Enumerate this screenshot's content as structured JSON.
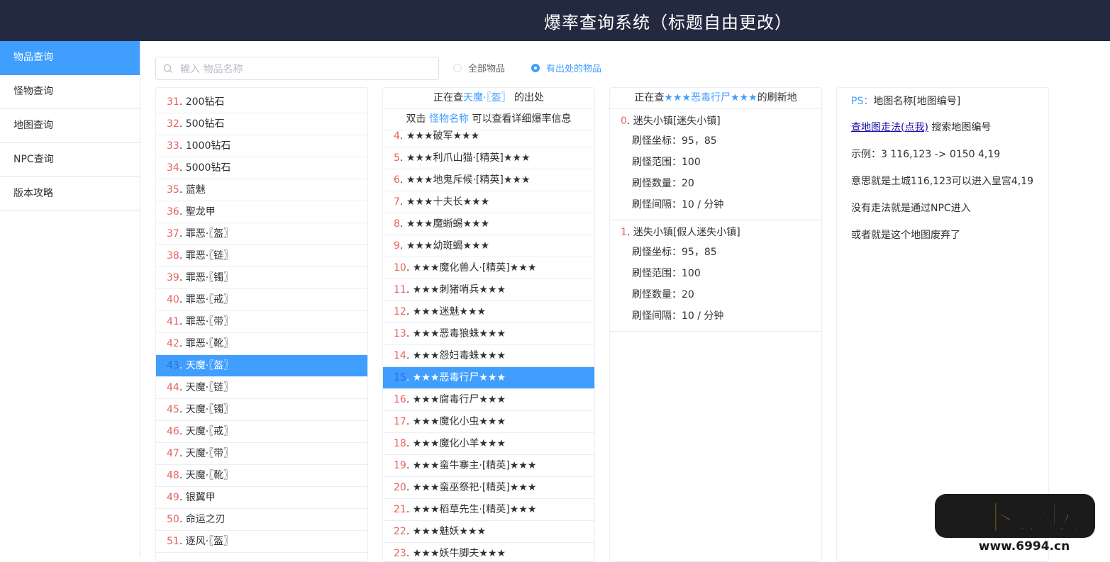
{
  "header": {
    "title": "爆率查询系统（标题自由更改）"
  },
  "sidebar": {
    "items": [
      {
        "label": "物品查询"
      },
      {
        "label": "怪物查询"
      },
      {
        "label": "地图查询"
      },
      {
        "label": "NPC查询"
      },
      {
        "label": "版本攻略"
      }
    ]
  },
  "search": {
    "placeholder": "输入 物品名称",
    "value": "",
    "icon": "search-icon"
  },
  "filters": {
    "all_label": "全部物品",
    "with_source_label": "有出处的物品",
    "selected": "有出处的物品"
  },
  "items_list": {
    "selected_num": "43",
    "rows": [
      {
        "num": "31",
        "name": "200钻石"
      },
      {
        "num": "32",
        "name": "500钻石"
      },
      {
        "num": "33",
        "name": "1000钻石"
      },
      {
        "num": "34",
        "name": "5000钻石"
      },
      {
        "num": "35",
        "name": "蓝魅"
      },
      {
        "num": "36",
        "name": "聖龙甲"
      },
      {
        "num": "37",
        "name": "罪恶·〖盔〗"
      },
      {
        "num": "38",
        "name": "罪恶·〖链〗"
      },
      {
        "num": "39",
        "name": "罪恶·〖镯〗"
      },
      {
        "num": "40",
        "name": "罪恶·〖戒〗"
      },
      {
        "num": "41",
        "name": "罪恶·〖带〗"
      },
      {
        "num": "42",
        "name": "罪恶·〖靴〗"
      },
      {
        "num": "43",
        "name": "天魔·〖盔〗"
      },
      {
        "num": "44",
        "name": "天魔·〖链〗"
      },
      {
        "num": "45",
        "name": "天魔·〖镯〗"
      },
      {
        "num": "46",
        "name": "天魔·〖戒〗"
      },
      {
        "num": "47",
        "name": "天魔·〖带〗"
      },
      {
        "num": "48",
        "name": "天魔·〖靴〗"
      },
      {
        "num": "49",
        "name": "银翼甲"
      },
      {
        "num": "50",
        "name": "命运之刃"
      },
      {
        "num": "51",
        "name": "逐风·〖盔〗"
      }
    ]
  },
  "monsters": {
    "head_prefix": "正在查",
    "head_item": "天魔·〖盔〗",
    "head_suffix": "的出处",
    "hint_prefix": "双击",
    "hint_link": "怪物名称",
    "hint_suffix": "可以查看详细爆率信息",
    "selected_num": "15",
    "rows": [
      {
        "num": "4",
        "name": "★★★破军★★★"
      },
      {
        "num": "5",
        "name": "★★★利爪山猫·[精英]★★★"
      },
      {
        "num": "6",
        "name": "★★★地鬼斥候·[精英]★★★"
      },
      {
        "num": "7",
        "name": "★★★十夫长★★★"
      },
      {
        "num": "8",
        "name": "★★★魔蜥蜴★★★"
      },
      {
        "num": "9",
        "name": "★★★幼斑蝎★★★"
      },
      {
        "num": "10",
        "name": "★★★魔化兽人·[精英]★★★"
      },
      {
        "num": "11",
        "name": "★★★刺猪哨兵★★★"
      },
      {
        "num": "12",
        "name": "★★★迷魅★★★"
      },
      {
        "num": "13",
        "name": "★★★恶毒狼蛛★★★"
      },
      {
        "num": "14",
        "name": "★★★怨妇毒蛛★★★"
      },
      {
        "num": "15",
        "name": "★★★恶毒行尸★★★"
      },
      {
        "num": "16",
        "name": "★★★腐毒行尸★★★"
      },
      {
        "num": "17",
        "name": "★★★魔化小虫★★★"
      },
      {
        "num": "18",
        "name": "★★★魔化小羊★★★"
      },
      {
        "num": "19",
        "name": "★★★蛮牛寨主·[精英]★★★"
      },
      {
        "num": "20",
        "name": "★★★蛮巫祭祀·[精英]★★★"
      },
      {
        "num": "21",
        "name": "★★★稻草先生·[精英]★★★"
      },
      {
        "num": "22",
        "name": "★★★魅妖★★★"
      },
      {
        "num": "23",
        "name": "★★★妖牛脚夫★★★"
      }
    ]
  },
  "spawns": {
    "head_prefix": "正在查",
    "head_monster": "★★★恶毒行尸★★★",
    "head_suffix": "的刷新地",
    "locations": [
      {
        "num": "0",
        "name": "迷失小镇[迷失小镇]",
        "coords_label": "刷怪坐标：",
        "coords": "95，85",
        "range_label": "刷怪范围：",
        "range": "100",
        "count_label": "刷怪数量：",
        "count": "20",
        "interval_label": "刷怪间隔：",
        "interval": "10 / 分钟"
      },
      {
        "num": "1",
        "name": "迷失小镇[假人迷失小镇]",
        "coords_label": "刷怪坐标：",
        "coords": "95，85",
        "range_label": "刷怪范围：",
        "range": "100",
        "count_label": "刷怪数量：",
        "count": "20",
        "interval_label": "刷怪间隔：",
        "interval": "10 / 分钟"
      }
    ]
  },
  "info": {
    "ps_label": "PS：",
    "ps_text": "地图名称[地图编号]",
    "link_text": "查地图走法(点我)",
    "link_after": " 搜索地图编号",
    "example": "示例：3 116,123 -> 0150 4,19",
    "meaning": "意思就是土城116,123可以进入皇宫4,19",
    "npc_note": "没有走法就是通过NPC进入",
    "abandoned_note": "或者就是这个地图废弃了"
  },
  "watermark": {
    "logo_text": "萝卜论坛",
    "url": "www.6994.cn"
  }
}
